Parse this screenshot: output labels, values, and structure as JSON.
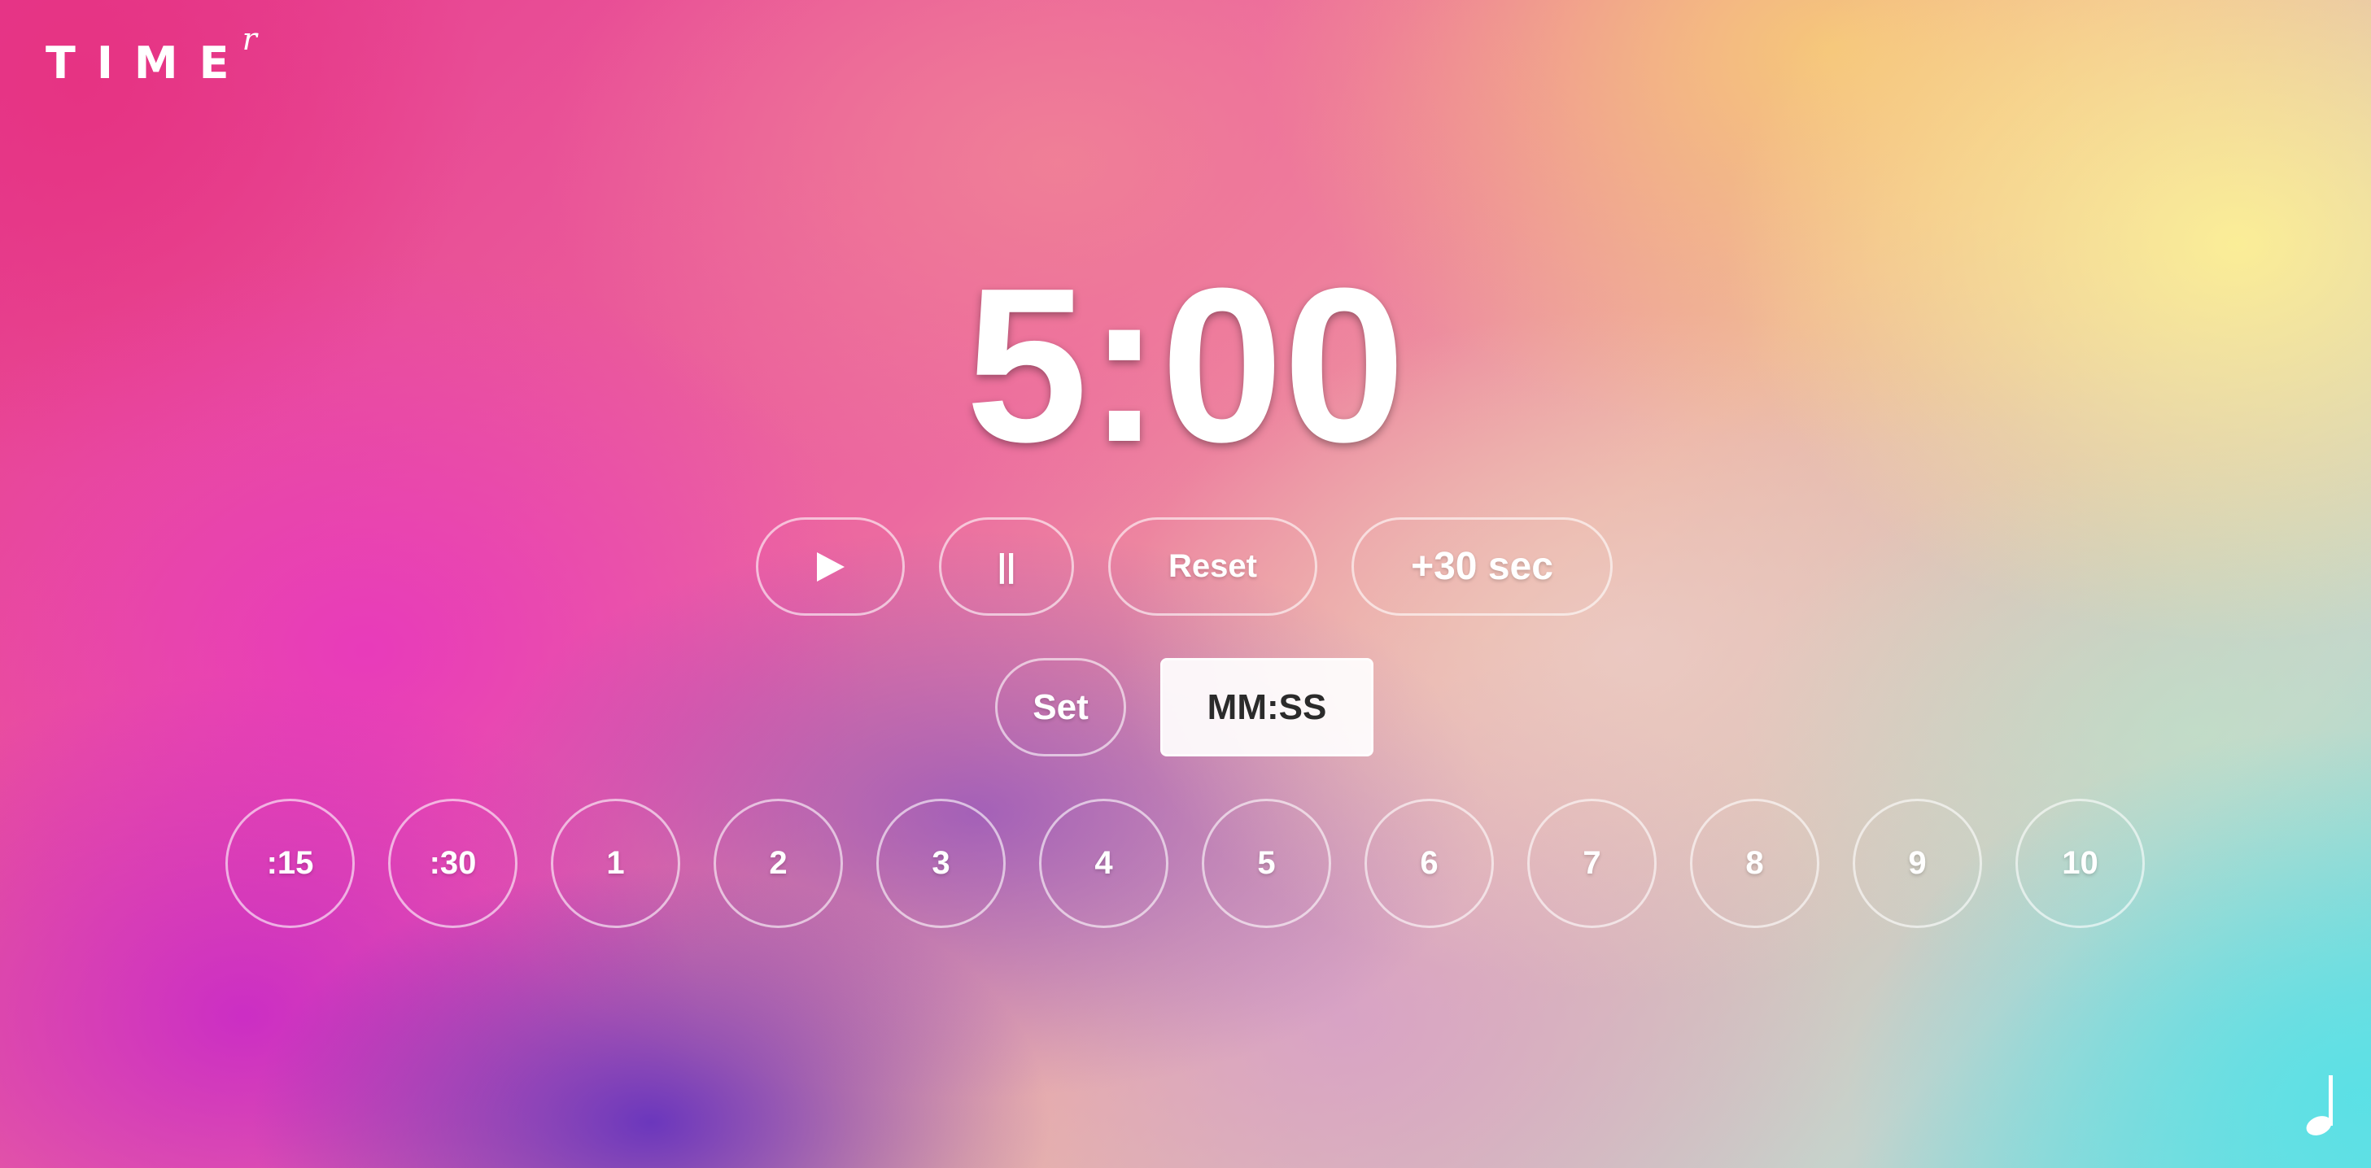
{
  "app": {
    "logo_main": "TIME",
    "logo_sup": "r"
  },
  "timer": {
    "display": "5:00"
  },
  "controls": {
    "play_icon": "play-icon",
    "pause_label": "||",
    "reset_label": "Reset",
    "add_label": "+30 sec"
  },
  "custom": {
    "set_label": "Set",
    "input_placeholder": "MM:SS",
    "input_value": ""
  },
  "presets": [
    ":15",
    ":30",
    "1",
    "2",
    "3",
    "4",
    "5",
    "6",
    "7",
    "8",
    "9",
    "10"
  ],
  "sound": {
    "icon": "music-note-icon"
  },
  "colors": {
    "text": "#ffffff",
    "input_bg": "#f8f4f6",
    "input_text": "#2b2b2b"
  }
}
